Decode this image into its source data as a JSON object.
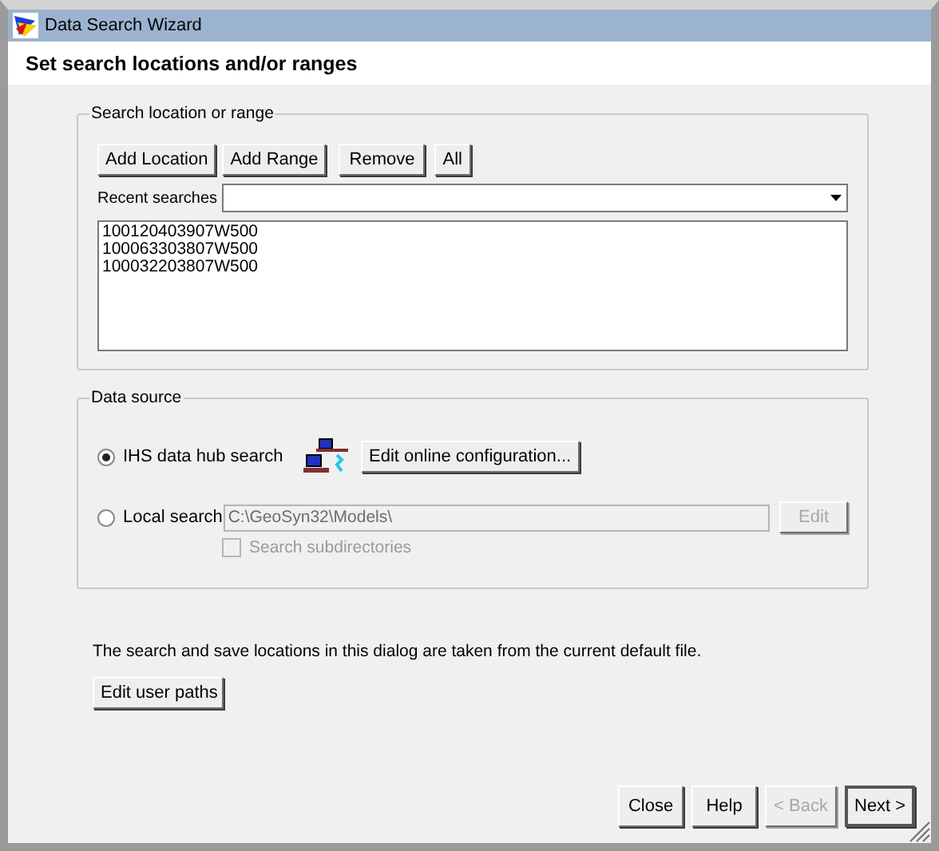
{
  "window": {
    "title": "Data Search Wizard"
  },
  "header": {
    "title": "Set search locations and/or ranges"
  },
  "search_group": {
    "title": "Search location or range",
    "buttons": [
      "Add Location",
      "Add Range",
      "Remove",
      "All"
    ],
    "recent_label": "Recent searches",
    "locations": [
      "100120403907W500",
      "100063303807W500",
      "100032203807W500"
    ]
  },
  "data_source": {
    "title": "Data source",
    "options": [
      {
        "kind": "hub",
        "label": "IHS data hub search",
        "selected": true,
        "button": {
          "label": "Edit online configuration...",
          "disabled": false
        }
      },
      {
        "kind": "local",
        "label": "Local search",
        "selected": false,
        "path": {
          "value": "C:\\GeoSyn32\\Models\\",
          "disabled": true
        },
        "button": {
          "label": "Edit",
          "disabled": true
        },
        "subdirectories": {
          "label": "Search subdirectories",
          "checked": false,
          "disabled": true
        }
      }
    ]
  },
  "note": "The search and save locations in this dialog are taken from the current default file.",
  "user_paths_button": "Edit user paths",
  "buttons": [
    {
      "label": "Close",
      "disabled": false,
      "default": false
    },
    {
      "label": "Help",
      "disabled": false,
      "default": false
    },
    {
      "label": "< Back",
      "disabled": true,
      "default": false
    },
    {
      "label": "Next >",
      "disabled": false,
      "default": true
    }
  ]
}
